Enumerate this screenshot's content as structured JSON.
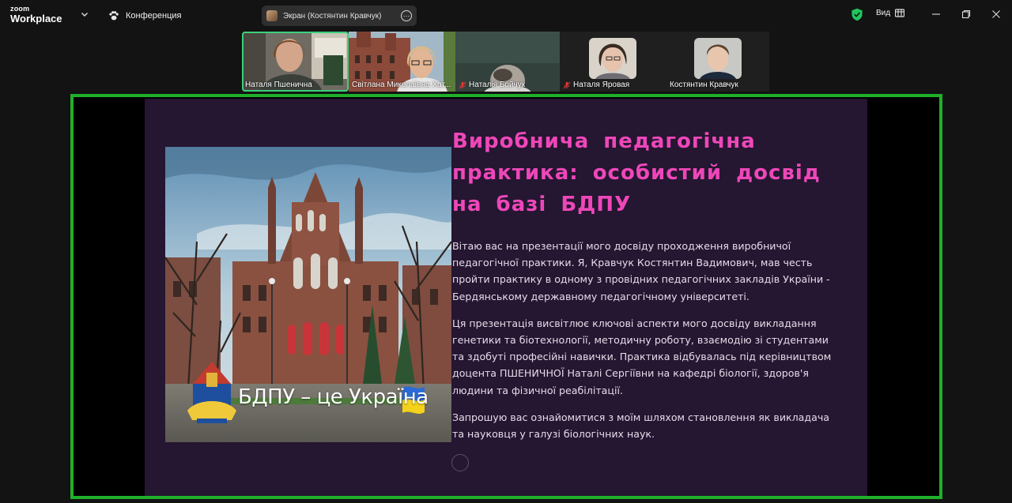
{
  "titlebar": {
    "brand_top": "zoom",
    "brand_bottom": "Workplace",
    "meeting_label": "Конференция",
    "share_label": "Экран (Костянтин Кравчук)",
    "view_label": "Вид"
  },
  "participants": [
    {
      "name": "Наталя Пшенична",
      "muted": false,
      "active": true
    },
    {
      "name": "Світлана Миколаївна Хат...",
      "muted": false,
      "active": false
    },
    {
      "name": "Наталія Бойчук",
      "muted": true,
      "active": false
    },
    {
      "name": "Наталя Яровая",
      "muted": true,
      "active": false
    },
    {
      "name": "Костянтин Кравчук",
      "muted": false,
      "active": false
    }
  ],
  "slide": {
    "badge": "БДПУ – це Україна",
    "title": "Виробнича педагогічна практика: особистий досвід на базі БДПУ",
    "paragraphs": [
      "Вітаю вас на презентації мого досвіду проходження виробничої педагогічної практики. Я, Кравчук Костянтин Вадимович, мав честь пройти практику в одному з провідних педагогічних закладів України - Бердянському державному педагогічному університеті.",
      "Ця презентація висвітлює ключові аспекти мого досвіду викладання генетики та біотехнології, методичну роботу, взаємодію зі студентами та здобуті професійні навички. Практика відбувалась під керівництвом доцента ПШЕНИЧНОЇ Наталі Сергіївни на кафедрі біології, здоров'я людини та фізичної реабілітації.",
      "Запрошую вас ознайомитися з моїм шляхом становлення як викладача та науковця у галузі біологічних наук."
    ]
  },
  "colors": {
    "share_border": "#1fb02a",
    "title_pink": "#ee47b9",
    "slide_bg": "#251631",
    "active_speaker": "#3bd07a",
    "shield_green": "#22c55e"
  }
}
